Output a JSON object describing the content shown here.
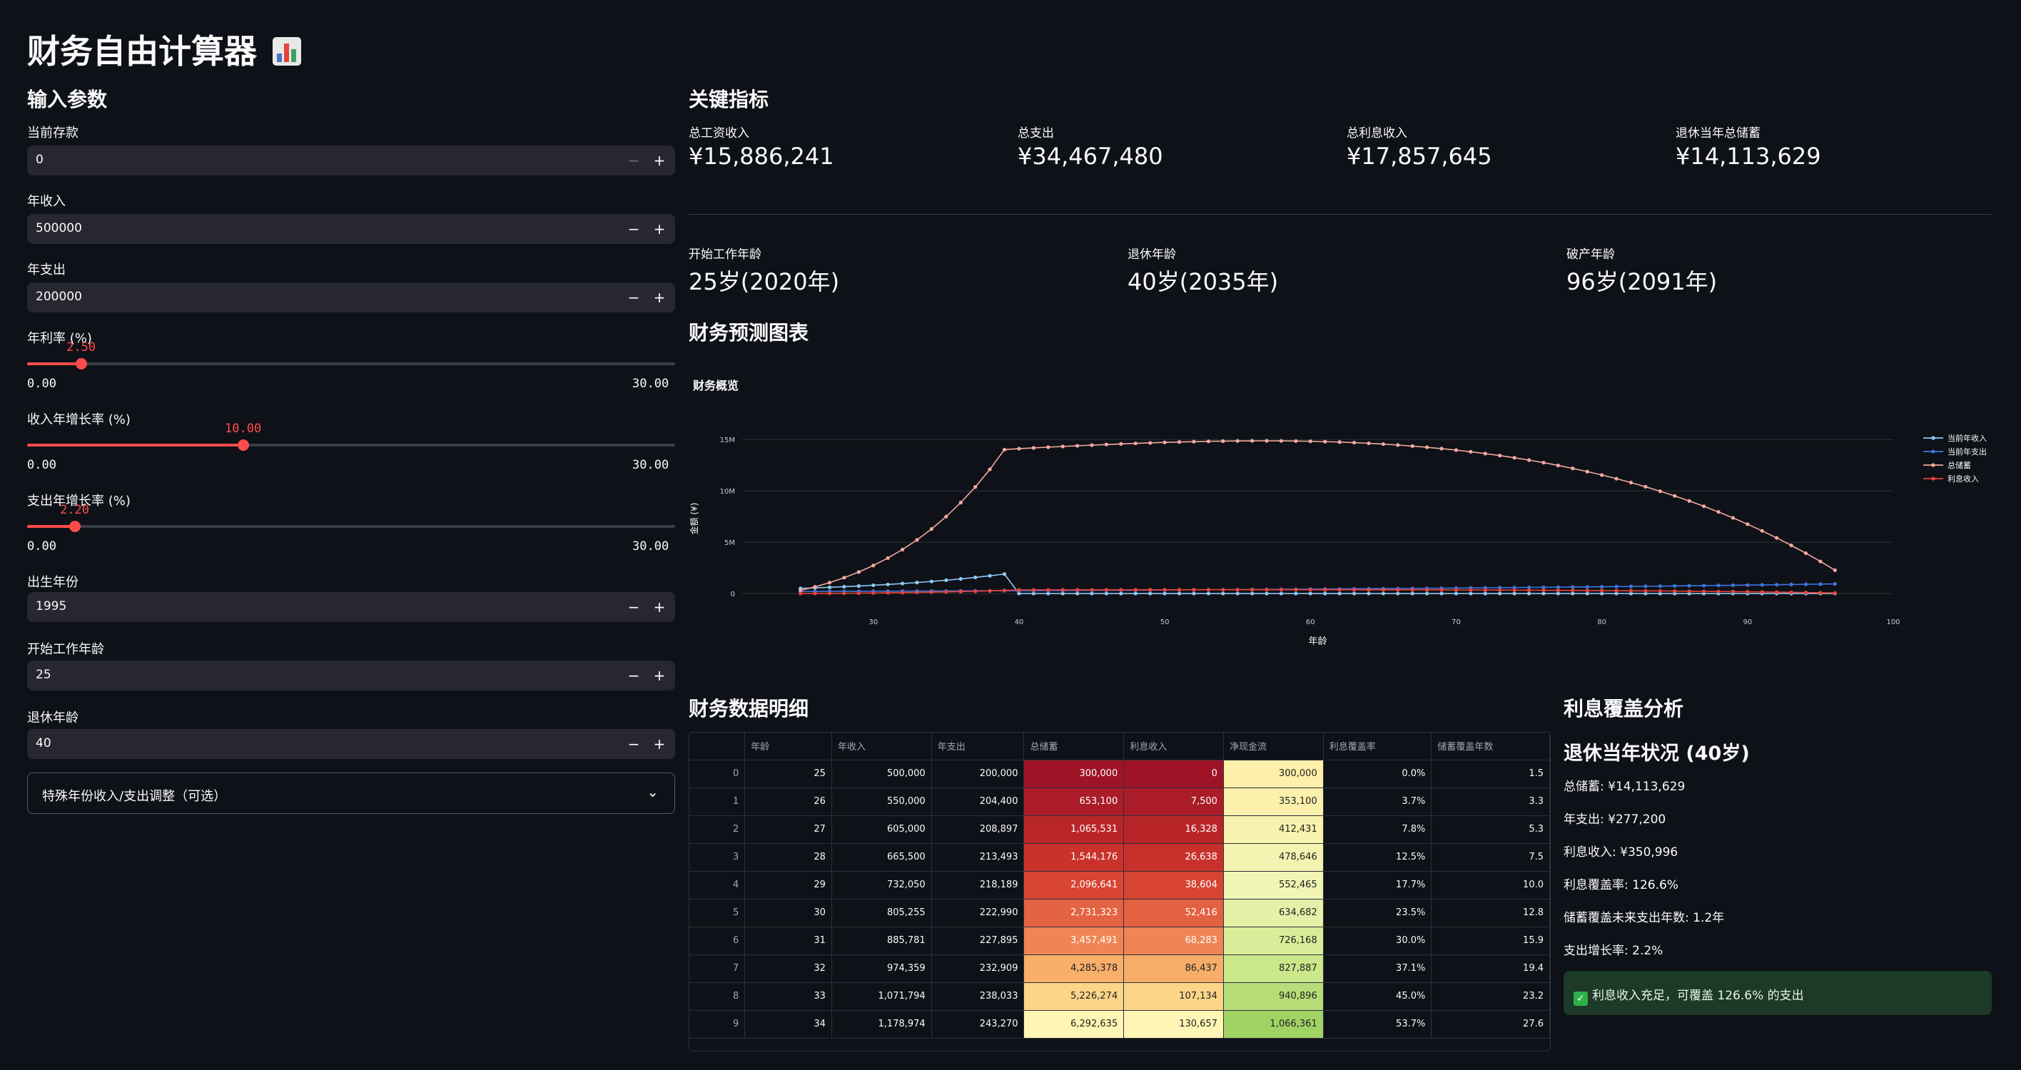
{
  "app_title": "财务自由计算器",
  "icons": {
    "title_icon": "bar-chart-icon",
    "expander_icon": "chevron-down-icon",
    "success_icon": "check-icon"
  },
  "colors": {
    "accent": "#ff4b4b",
    "background": "#0e1117",
    "input_bg": "#262730",
    "success_bg": "#1c3a27"
  },
  "sidebar": {
    "title": "输入参数",
    "savings": {
      "label": "当前存款",
      "value": "0"
    },
    "income": {
      "label": "年收入",
      "value": "500000"
    },
    "expense": {
      "label": "年支出",
      "value": "200000"
    },
    "interest_rate": {
      "label": "年利率 (%)",
      "value": "2.50",
      "fraction": 0.0833,
      "min": "0.00",
      "max": "30.00"
    },
    "income_growth": {
      "label": "收入年增长率 (%)",
      "value": "10.00",
      "fraction": 0.3333,
      "min": "0.00",
      "max": "30.00"
    },
    "expense_growth": {
      "label": "支出年增长率 (%)",
      "value": "2.20",
      "fraction": 0.0733,
      "min": "0.00",
      "max": "30.00"
    },
    "birth_year": {
      "label": "出生年份",
      "value": "1995"
    },
    "start_age": {
      "label": "开始工作年龄",
      "value": "25"
    },
    "retire_age": {
      "label": "退休年龄",
      "value": "40"
    },
    "expander_label": "特殊年份收入/支出调整（可选）"
  },
  "metrics": {
    "title": "关键指标",
    "row1": [
      {
        "label": "总工资收入",
        "value": "¥15,886,241"
      },
      {
        "label": "总支出",
        "value": "¥34,467,480"
      },
      {
        "label": "总利息收入",
        "value": "¥17,857,645"
      },
      {
        "label": "退休当年总储蓄",
        "value": "¥14,113,629"
      }
    ],
    "row2": [
      {
        "label": "开始工作年龄",
        "value": "25岁(2020年)"
      },
      {
        "label": "退休年龄",
        "value": "40岁(2035年)"
      },
      {
        "label": "破产年龄",
        "value": "96岁(2091年)"
      }
    ]
  },
  "chart_section_title": "财务预测图表",
  "chart_data": {
    "type": "line",
    "title": "财务概览",
    "xlabel": "年龄",
    "ylabel": "金额 (¥)",
    "xlim": [
      21,
      100
    ],
    "ylim": [
      -900000,
      15500000
    ],
    "xticks": [
      30,
      40,
      50,
      60,
      70,
      80,
      90,
      100
    ],
    "yticks": [
      0,
      5000000,
      10000000,
      15000000
    ],
    "ytick_labels": [
      "0",
      "5M",
      "10M",
      "15M"
    ],
    "legend_position": "top-right",
    "x": [
      25,
      26,
      27,
      28,
      29,
      30,
      31,
      32,
      33,
      34,
      35,
      36,
      37,
      38,
      39,
      40,
      41,
      42,
      43,
      44,
      45,
      46,
      47,
      48,
      49,
      50,
      51,
      52,
      53,
      54,
      55,
      56,
      57,
      58,
      59,
      60,
      61,
      62,
      63,
      64,
      65,
      66,
      67,
      68,
      69,
      70,
      71,
      72,
      73,
      74,
      75,
      76,
      77,
      78,
      79,
      80,
      81,
      82,
      83,
      84,
      85,
      86,
      87,
      88,
      89,
      90,
      91,
      92,
      93,
      94,
      95,
      96
    ],
    "series": [
      {
        "name": "当前年收入",
        "color": "#8ec9f5",
        "values": [
          500000,
          550000,
          605000,
          665500,
          732050,
          805255,
          885781,
          974359,
          1071794,
          1178974,
          1296871,
          1426558,
          1569214,
          1726135,
          1898749,
          0,
          0,
          0,
          0,
          0,
          0,
          0,
          0,
          0,
          0,
          0,
          0,
          0,
          0,
          0,
          0,
          0,
          0,
          0,
          0,
          0,
          0,
          0,
          0,
          0,
          0,
          0,
          0,
          0,
          0,
          0,
          0,
          0,
          0,
          0,
          0,
          0,
          0,
          0,
          0,
          0,
          0,
          0,
          0,
          0,
          0,
          0,
          0,
          0,
          0,
          0,
          0,
          0,
          0,
          0,
          0,
          0
        ]
      },
      {
        "name": "当前年支出",
        "color": "#3f74e0",
        "values": [
          200000,
          204400,
          208897,
          213493,
          218189,
          222990,
          227895,
          232909,
          238033,
          243270,
          248621,
          254091,
          259681,
          265394,
          271233,
          277200,
          283298,
          289531,
          295901,
          302410,
          309063,
          315863,
          322812,
          329914,
          337172,
          344590,
          352171,
          359918,
          367837,
          375929,
          384200,
          392652,
          401290,
          410119,
          419142,
          428363,
          437786,
          447418,
          457261,
          467320,
          477601,
          488109,
          498847,
          509821,
          521038,
          532500,
          544215,
          556188,
          568424,
          580929,
          593710,
          606771,
          620118,
          633761,
          647704,
          661953,
          676516,
          691399,
          706610,
          722157,
          738044,
          754280,
          770875,
          787834,
          805166,
          822879,
          840982,
          859485,
          878393,
          897718,
          917467,
          937652
        ]
      },
      {
        "name": "总储蓄",
        "color": "#f4a9a0",
        "values": [
          300000,
          653100,
          1065531,
          1544176,
          2096641,
          2731323,
          3457491,
          4285378,
          5226274,
          6292635,
          7497700,
          8856200,
          10384100,
          12098600,
          14018300,
          14113629,
          14186600,
          14257600,
          14326400,
          14392700,
          14456200,
          14516600,
          14573600,
          14626900,
          14676100,
          14720800,
          14760700,
          14795300,
          14824300,
          14847200,
          14863600,
          14872900,
          14874800,
          14868700,
          14854000,
          14830300,
          14797000,
          14753500,
          14699300,
          14633900,
          14556600,
          14466900,
          14364200,
          14247700,
          14117000,
          13971400,
          13810300,
          13633000,
          13438900,
          13227200,
          12997300,
          12748300,
          12479500,
          12190000,
          11879100,
          11545700,
          11189000,
          10808000,
          10401800,
          9969300,
          9509400,
          9021000,
          8502900,
          7953800,
          7372200,
          6757000,
          6106700,
          5419800,
          4694800,
          3930400,
          3124800,
          2276200
        ]
      },
      {
        "name": "利息收入",
        "color": "#e8433b",
        "values": [
          0,
          7500,
          16328,
          26638,
          38604,
          52416,
          68283,
          86437,
          107134,
          130657,
          157300,
          187400,
          221400,
          259700,
          302400,
          350996,
          352800,
          356400,
          358100,
          359800,
          361400,
          362900,
          364300,
          365700,
          366900,
          368000,
          369000,
          369900,
          370600,
          371200,
          371600,
          371800,
          371900,
          371700,
          371400,
          370800,
          370000,
          368800,
          367500,
          365800,
          363900,
          361700,
          359100,
          356200,
          352900,
          349300,
          345300,
          340800,
          336000,
          330700,
          324900,
          318700,
          312000,
          304800,
          297000,
          288600,
          279700,
          270200,
          260000,
          249200,
          237700,
          225500,
          212600,
          198800,
          184300,
          168900,
          152700,
          135500,
          117400,
          98300,
          78100,
          56900
        ]
      }
    ]
  },
  "table": {
    "title": "财务数据明细",
    "columns": [
      "",
      "年龄",
      "年收入",
      "年支出",
      "总储蓄",
      "利息收入",
      "净现金流",
      "利息覆盖率",
      "储蓄覆盖年数"
    ],
    "rows": [
      [
        "0",
        "25",
        "500,000",
        "200,000",
        "300,000",
        "0",
        "300,000",
        "0.0%",
        "1.5"
      ],
      [
        "1",
        "26",
        "550,000",
        "204,400",
        "653,100",
        "7,500",
        "353,100",
        "3.7%",
        "3.3"
      ],
      [
        "2",
        "27",
        "605,000",
        "208,897",
        "1,065,531",
        "16,328",
        "412,431",
        "7.8%",
        "5.3"
      ],
      [
        "3",
        "28",
        "665,500",
        "213,493",
        "1,544,176",
        "26,638",
        "478,646",
        "12.5%",
        "7.5"
      ],
      [
        "4",
        "29",
        "732,050",
        "218,189",
        "2,096,641",
        "38,604",
        "552,465",
        "17.7%",
        "10.0"
      ],
      [
        "5",
        "30",
        "805,255",
        "222,990",
        "2,731,323",
        "52,416",
        "634,682",
        "23.5%",
        "12.8"
      ],
      [
        "6",
        "31",
        "885,781",
        "227,895",
        "3,457,491",
        "68,283",
        "726,168",
        "30.0%",
        "15.9"
      ],
      [
        "7",
        "32",
        "974,359",
        "232,909",
        "4,285,378",
        "86,437",
        "827,887",
        "37.1%",
        "19.4"
      ],
      [
        "8",
        "33",
        "1,071,794",
        "238,033",
        "5,226,274",
        "107,134",
        "940,896",
        "45.0%",
        "23.2"
      ],
      [
        "9",
        "34",
        "1,178,974",
        "243,270",
        "6,292,635",
        "130,657",
        "1,066,361",
        "53.7%",
        "27.6"
      ]
    ]
  },
  "analysis": {
    "title": "利息覆盖分析",
    "subtitle": "退休当年状况 (40岁)",
    "lines": [
      "总储蓄: ¥14,113,629",
      "年支出: ¥277,200",
      "利息收入: ¥350,996",
      "利息覆盖率: 126.6%",
      "储蓄覆盖未来支出年数: 1.2年",
      "支出增长率: 2.2%"
    ],
    "success_text": "利息收入充足，可覆盖 126.6% 的支出"
  }
}
